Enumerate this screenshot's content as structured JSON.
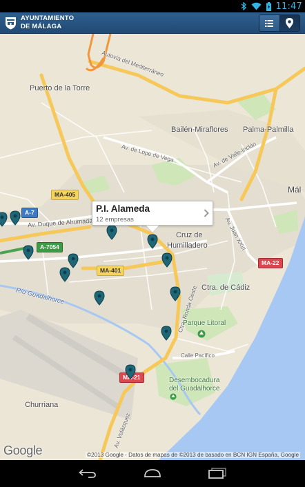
{
  "status_bar": {
    "time": "11:47",
    "icons": [
      "bluetooth-icon",
      "wifi-icon",
      "battery-icon"
    ]
  },
  "app_bar": {
    "title_line1": "AYUNTAMIENTO",
    "title_line2": "DE MÁLAGA",
    "logo_icon": "city-crest-icon",
    "view_toggle": [
      "list-view-icon",
      "map-view-icon"
    ],
    "active_view": "map",
    "colors": {
      "bar": "#214a74",
      "active_toggle": "#16324f"
    }
  },
  "map": {
    "labels": {
      "puerto_torre": "Puerto de la Torre",
      "bailen": "Bailén-Miraflores",
      "palma": "Palma-Palmilla",
      "malaga": "Mál",
      "cruz1": "Cruz de",
      "cruz2": "Humilladero",
      "ctra_cadiz": "Ctra. de Cádiz",
      "churriana": "Churriana",
      "autovia": "Autovía del Mediterráneo",
      "lope_vega": "Av. de Lope de Vega",
      "valle_inclan": "Av. de Valle-Inclán",
      "duque_ahumada": "Av. Duque de Ahumada",
      "juan_xxiii": "Av. Juan XXIII",
      "ronda_oeste": "Ctra. Ronda Oeste",
      "rio_guadalhorce": "Río Guadalhorce",
      "parque_litoral": "Parque Litoral",
      "calle_pacifico": "Calle Pacífico",
      "desembocadura1": "Desembocadura",
      "desembocadura2": "del Guadalhorce",
      "velazquez": "Av. Velázquez"
    },
    "shields": {
      "ma405": "MA-405",
      "a7": "A-7",
      "a7054": "A-7054",
      "ma401": "MA-401",
      "ma22": "MA-22",
      "ma21": "MA-21"
    },
    "marker_count": 12,
    "marker_color": "#1f6677",
    "info_window": {
      "title": "P.I. Alameda",
      "subtitle": "12 empresas"
    },
    "google_logo": "Google",
    "attribution": "©2013 Google - Datos de mapas de ©2013 de basado en BCN IGN España, Google",
    "colors": {
      "land": "#ece6d6",
      "sea": "#a6c8f2",
      "highway": "#f6c859",
      "park": "#cde8b8"
    }
  },
  "nav_bar": {
    "buttons": [
      "back-icon",
      "home-icon",
      "recent-apps-icon"
    ]
  }
}
